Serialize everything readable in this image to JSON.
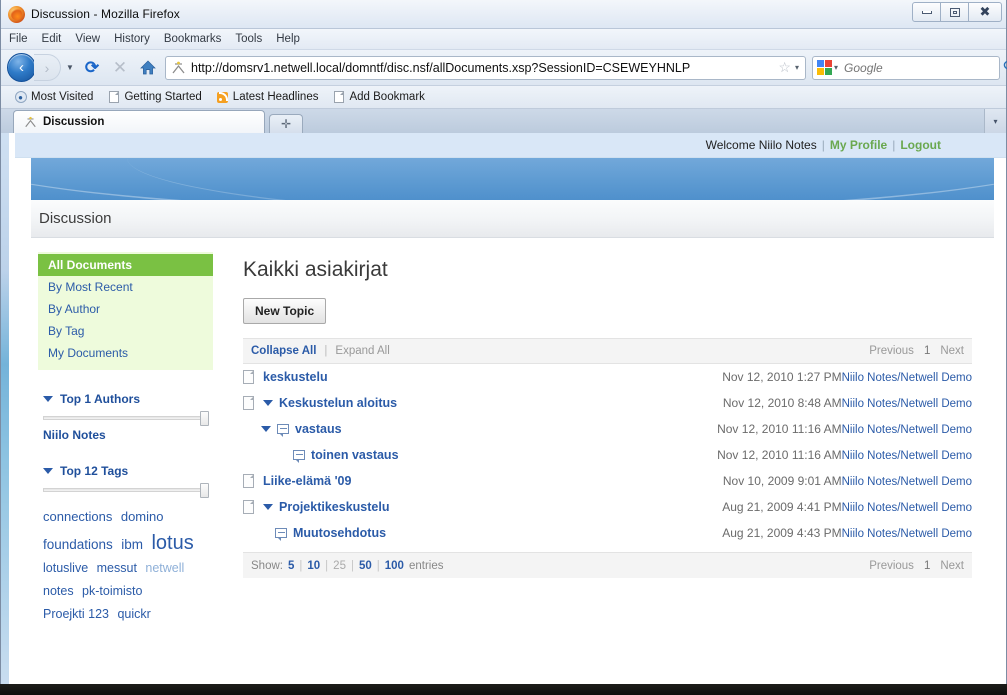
{
  "window": {
    "title": "Discussion - Mozilla Firefox",
    "minimize_label": "Minimize",
    "maximize_label": "Maximize",
    "close_label": "Close"
  },
  "menubar": {
    "items": [
      "File",
      "Edit",
      "View",
      "History",
      "Bookmarks",
      "Tools",
      "Help"
    ]
  },
  "navbar": {
    "back_glyph": "‹",
    "forward_glyph": "›",
    "dropdown_glyph": "▼",
    "reload_glyph": "⟳",
    "stop_glyph": "✕",
    "home_glyph": "⌂",
    "url": "http://domsrv1.netwell.local/domntf/disc.nsf/allDocuments.xsp?SessionID=CSEWEYHNLP",
    "star_glyph": "☆",
    "caret_glyph": "▾",
    "search_placeholder": "Google",
    "search_value": "",
    "search_glyph": "ὐD"
  },
  "bookmarks": {
    "items": [
      {
        "label": "Most Visited",
        "icon": "compass-icon"
      },
      {
        "label": "Getting Started",
        "icon": "page-icon"
      },
      {
        "label": "Latest Headlines",
        "icon": "rss-icon"
      },
      {
        "label": "Add Bookmark",
        "icon": "page-icon"
      }
    ]
  },
  "tabs": {
    "active": "Discussion",
    "new_tab_glyph": "✛",
    "list_glyph": "▾"
  },
  "page": {
    "welcome": {
      "text": "Welcome Niilo Notes",
      "sep": "|",
      "profile_label": "My Profile",
      "logout_label": "Logout"
    },
    "app_title": "Discussion",
    "sidebar": {
      "nav_items": [
        {
          "label": "All Documents",
          "active": true
        },
        {
          "label": "By Most Recent",
          "active": false
        },
        {
          "label": "By Author",
          "active": false
        },
        {
          "label": "By Tag",
          "active": false
        },
        {
          "label": "My Documents",
          "active": false
        }
      ],
      "authors_section": {
        "heading": "Top 1 Authors",
        "names": [
          "Niilo Notes"
        ]
      },
      "tags_section": {
        "heading": "Top 12 Tags",
        "tags": [
          {
            "label": "connections",
            "size": 13,
            "dim": false
          },
          {
            "label": "domino",
            "size": 13,
            "dim": false
          },
          {
            "label": "foundations",
            "size": 13.5,
            "dim": false
          },
          {
            "label": "ibm",
            "size": 13.5,
            "dim": false
          },
          {
            "label": "lotus",
            "size": 20,
            "dim": false
          },
          {
            "label": "lotuslive",
            "size": 12.5,
            "dim": false
          },
          {
            "label": "messut",
            "size": 12.5,
            "dim": false
          },
          {
            "label": "netwell",
            "size": 12.5,
            "dim": true
          },
          {
            "label": "notes",
            "size": 12.5,
            "dim": false
          },
          {
            "label": "pk-toimisto",
            "size": 12.5,
            "dim": false
          },
          {
            "label": "Proejkti 123",
            "size": 12.5,
            "dim": false
          },
          {
            "label": "quickr",
            "size": 12.5,
            "dim": false
          }
        ]
      }
    },
    "main": {
      "title": "Kaikki asiakirjat",
      "new_topic_label": "New Topic",
      "collapse_label": "Collapse All",
      "expand_label": "Expand All",
      "pager": {
        "previous": "Previous",
        "page": "1",
        "next": "Next"
      },
      "rows": [
        {
          "title": "keskustelu",
          "icon": "document-icon",
          "indent": 0,
          "twisty": false,
          "date": "Nov 12, 2010 1:27 PM",
          "author": "Niilo Notes/Netwell Demo"
        },
        {
          "title": "Keskustelun aloitus",
          "icon": "document-icon",
          "indent": 0,
          "twisty": true,
          "date": "Nov 12, 2010 8:48 AM",
          "author": "Niilo Notes/Netwell Demo"
        },
        {
          "title": "vastaus",
          "icon": "comment-icon",
          "indent": 1,
          "twisty": true,
          "date": "Nov 12, 2010 11:16 AM",
          "author": "Niilo Notes/Netwell Demo"
        },
        {
          "title": "toinen vastaus",
          "icon": "comment-icon",
          "indent": 2,
          "twisty": false,
          "date": "Nov 12, 2010 11:16 AM",
          "author": "Niilo Notes/Netwell Demo"
        },
        {
          "title": "Liike-elämä '09",
          "icon": "document-icon",
          "indent": 0,
          "twisty": false,
          "date": "Nov 10, 2009 9:01 AM",
          "author": "Niilo Notes/Netwell Demo"
        },
        {
          "title": "Projektikeskustelu",
          "icon": "document-icon",
          "indent": 0,
          "twisty": true,
          "date": "Aug 21, 2009 4:41 PM",
          "author": "Niilo Notes/Netwell Demo"
        },
        {
          "title": "Muutosehdotus",
          "icon": "comment-icon",
          "indent": 1,
          "twisty": false,
          "date": "Aug 21, 2009 4:43 PM",
          "author": "Niilo Notes/Netwell Demo"
        }
      ],
      "showbar": {
        "prefix": "Show:",
        "suffix": "entries",
        "options": [
          {
            "label": "5",
            "selected": false
          },
          {
            "label": "10",
            "selected": false
          },
          {
            "label": "25",
            "selected": true
          },
          {
            "label": "50",
            "selected": false
          },
          {
            "label": "100",
            "selected": false
          }
        ]
      }
    }
  },
  "colors": {
    "accent_green": "#7ac143",
    "link_blue": "#2b5ba8",
    "banner_blue": "#5e9bd2",
    "nav_bg_green": "#eefbdc"
  }
}
